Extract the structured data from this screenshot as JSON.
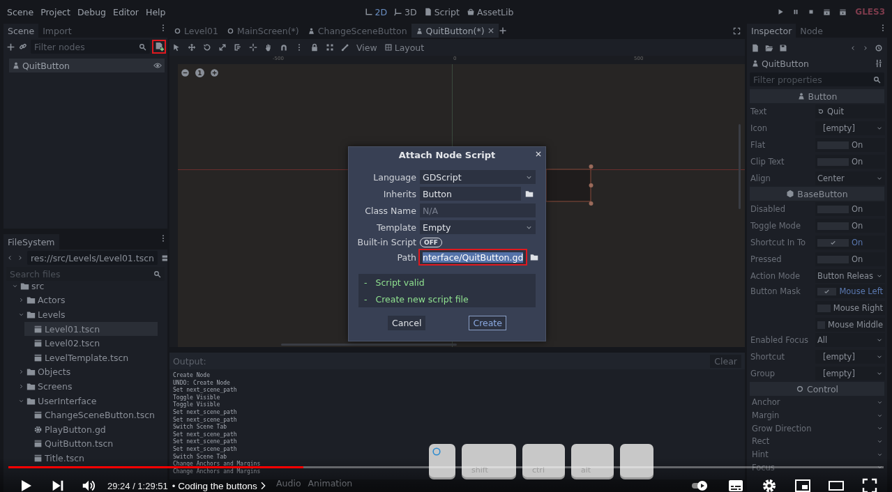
{
  "menu": [
    "Scene",
    "Project",
    "Debug",
    "Editor",
    "Help"
  ],
  "workspaces": [
    {
      "label": "2D",
      "kind": "planar",
      "selected": true
    },
    {
      "label": "3D",
      "kind": "spatial",
      "selected": false
    },
    {
      "label": "Script",
      "kind": "script",
      "selected": false
    },
    {
      "label": "AssetLib",
      "kind": "assetlib",
      "selected": false
    }
  ],
  "renderer": "GLES3",
  "scene_dock": {
    "tabs": [
      {
        "label": "Scene",
        "selected": true
      },
      {
        "label": "Import",
        "selected": false
      }
    ],
    "filter_placeholder": "Filter nodes",
    "attach_highlighted": true,
    "nodes": [
      {
        "name": "QuitButton",
        "selected": true
      }
    ]
  },
  "filesystem": {
    "tab": "FileSystem",
    "path": "res://src/Levels/Level01.tscn",
    "search_placeholder": "Search files",
    "tree": [
      {
        "name": "src",
        "kind": "folder",
        "expanded": true,
        "selected": false,
        "children": [
          {
            "name": "Actors",
            "kind": "folder",
            "expanded": false,
            "selected": false
          },
          {
            "name": "Levels",
            "kind": "folder",
            "expanded": true,
            "selected": false,
            "children": [
              {
                "name": "Level01.tscn",
                "kind": "scene",
                "selected": true
              },
              {
                "name": "Level02.tscn",
                "kind": "scene",
                "selected": false
              },
              {
                "name": "LevelTemplate.tscn",
                "kind": "scene",
                "selected": false
              }
            ]
          },
          {
            "name": "Objects",
            "kind": "folder",
            "expanded": false,
            "selected": false
          },
          {
            "name": "Screens",
            "kind": "folder",
            "expanded": false,
            "selected": false
          },
          {
            "name": "UserInterface",
            "kind": "folder",
            "expanded": true,
            "selected": false,
            "children": [
              {
                "name": "ChangeSceneButton.tscn",
                "kind": "scene",
                "selected": false
              },
              {
                "name": "PlayButton.gd",
                "kind": "script",
                "selected": false
              },
              {
                "name": "QuitButton.tscn",
                "kind": "scene",
                "selected": false
              },
              {
                "name": "Title.tscn",
                "kind": "scene",
                "selected": false
              }
            ]
          }
        ]
      }
    ]
  },
  "editor_tabs": [
    {
      "label": "Level01",
      "kind": "node",
      "selected": false
    },
    {
      "label": "MainScreen(*)",
      "kind": "node",
      "selected": false
    },
    {
      "label": "ChangeSceneButton",
      "kind": "button",
      "selected": false
    },
    {
      "label": "QuitButton(*)",
      "kind": "button",
      "selected": true
    }
  ],
  "toolbar": {
    "view": "View",
    "layout": "Layout"
  },
  "viewport": {
    "ruler_labels": [
      "-500",
      "0",
      "500"
    ],
    "zoom_reset": "1"
  },
  "dialog": {
    "title": "Attach Node Script",
    "fields": [
      {
        "label": "Language",
        "kind": "dropdown",
        "value": "GDScript",
        "highlighted": false
      },
      {
        "label": "Inherits",
        "kind": "browse",
        "value": "Button",
        "highlighted": false
      },
      {
        "label": "Class Name",
        "kind": "text",
        "placeholder": "N/A",
        "highlighted": false
      },
      {
        "label": "Template",
        "kind": "dropdown",
        "value": "Empty",
        "highlighted": false
      },
      {
        "label": "Built-in Script",
        "kind": "toggle",
        "value": "OFF",
        "on": false,
        "highlighted": false
      },
      {
        "label": "Path",
        "kind": "browse",
        "value": "nterface/QuitButton.gd",
        "highlighted": true
      }
    ],
    "messages": [
      {
        "bullet": "-",
        "text": "Script valid"
      },
      {
        "bullet": "-",
        "text": "Create new script file"
      }
    ],
    "buttons": [
      {
        "label": "Cancel",
        "focused": false
      },
      {
        "label": "Create",
        "focused": true
      }
    ]
  },
  "output": {
    "title": "Output:",
    "clear": "Clear",
    "lines": [
      "Create Node",
      "UNDO: Create Node",
      "Set next_scene_path",
      "Toggle Visible",
      "Toggle Visible",
      "Set next_scene_path",
      "Set next_scene_path",
      "Switch Scene Tab",
      "Set next_scene_path",
      "Set next_scene_path",
      "Set next_scene_path",
      "Switch Scene Tab",
      "Change Anchors and Margins",
      "Change Anchors and Margins"
    ]
  },
  "bottom_tabs": [
    "Audio",
    "Animation"
  ],
  "inspector": {
    "tabs": [
      {
        "label": "Inspector",
        "selected": true
      },
      {
        "label": "Node",
        "selected": false
      }
    ],
    "node": "QuitButton",
    "filter_placeholder": "Filter properties",
    "sections": [
      {
        "title": "Button",
        "kind": "button",
        "properties": [
          {
            "label": "Text",
            "kind": "text",
            "value": "Quit"
          },
          {
            "label": "Icon",
            "kind": "resource",
            "value": "[empty]"
          },
          {
            "label": "Flat",
            "kind": "check",
            "value": "On",
            "checked": false
          },
          {
            "label": "Clip Text",
            "kind": "check",
            "value": "On",
            "checked": false
          },
          {
            "label": "Align",
            "kind": "enum",
            "value": "Center"
          }
        ]
      },
      {
        "title": "BaseButton",
        "kind": "cube",
        "properties": [
          {
            "label": "Disabled",
            "kind": "check",
            "value": "On",
            "checked": false
          },
          {
            "label": "Toggle Mode",
            "kind": "check",
            "value": "On",
            "checked": false
          },
          {
            "label": "Shortcut In To",
            "kind": "check",
            "value": "On",
            "checked": true
          },
          {
            "label": "Pressed",
            "kind": "check",
            "value": "On",
            "checked": false
          },
          {
            "label": "Action Mode",
            "kind": "enum",
            "value": "Button Releas"
          },
          {
            "label": "Button Mask",
            "kind": "flags",
            "options": [
              {
                "label": "Mouse Left",
                "checked": true
              },
              {
                "label": "Mouse Right",
                "checked": false
              },
              {
                "label": "Mouse Middle",
                "checked": false
              }
            ]
          },
          {
            "label": "Enabled Focus",
            "kind": "enum",
            "value": "All"
          },
          {
            "label": "Shortcut",
            "kind": "resource",
            "value": "[empty]"
          },
          {
            "label": "Group",
            "kind": "resource",
            "value": "[empty]"
          }
        ]
      },
      {
        "title": "Control",
        "kind": "circle",
        "properties": [
          {
            "label": "Anchor",
            "kind": "group"
          },
          {
            "label": "Margin",
            "kind": "group"
          },
          {
            "label": "Grow Direction",
            "kind": "group"
          },
          {
            "label": "Rect",
            "kind": "group"
          },
          {
            "label": "Hint",
            "kind": "group"
          },
          {
            "label": "Focus",
            "kind": "group"
          }
        ]
      }
    ]
  },
  "key_overlay": [
    {
      "kind": "icon"
    },
    {
      "kind": "label",
      "label": "shift"
    },
    {
      "kind": "label",
      "label": "ctrl"
    },
    {
      "kind": "label",
      "label": "alt"
    },
    {
      "kind": "blank"
    }
  ],
  "player": {
    "progress": {
      "level": 0.337
    },
    "time": "29:24 / 1:29:51",
    "separator": "•",
    "chapter": "Coding the buttons"
  }
}
